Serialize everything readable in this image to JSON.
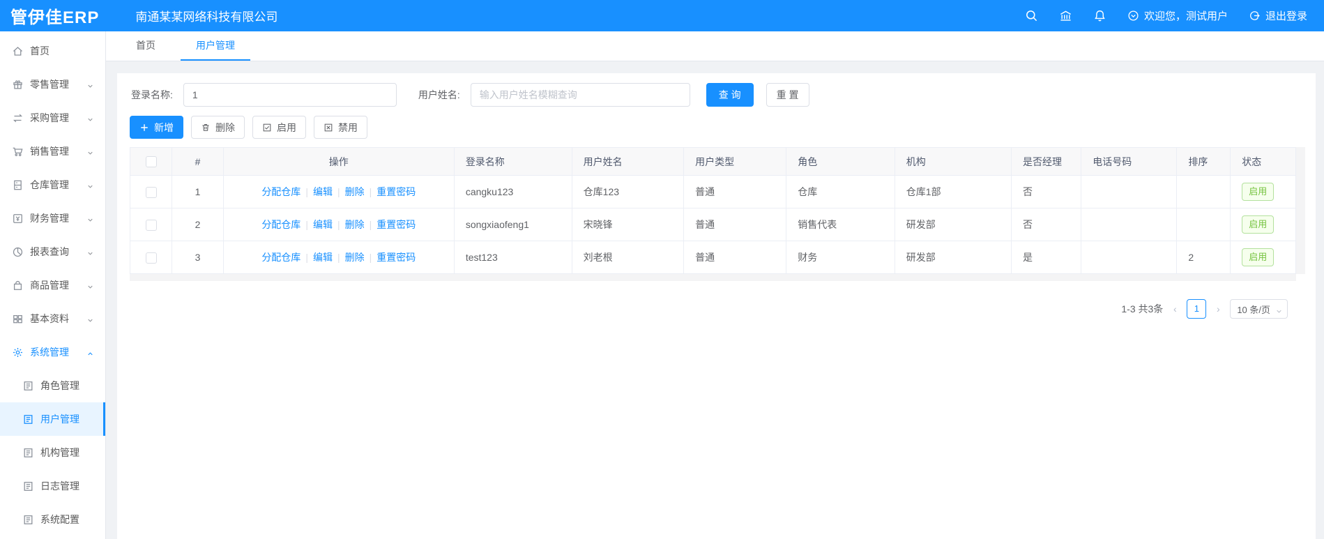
{
  "header": {
    "logo": "管伊佳ERP",
    "company": "南通某某网络科技有限公司",
    "welcome": "欢迎您，测试用户",
    "logout": "退出登录",
    "icons": [
      "search-icon",
      "bank-icon",
      "bell-icon",
      "user-circle-icon",
      "logout-icon"
    ]
  },
  "sidebar": {
    "items": [
      {
        "label": "首页",
        "icon": "home-icon",
        "has_children": false
      },
      {
        "label": "零售管理",
        "icon": "retail-icon",
        "has_children": true
      },
      {
        "label": "采购管理",
        "icon": "purchase-icon",
        "has_children": true
      },
      {
        "label": "销售管理",
        "icon": "sales-icon",
        "has_children": true
      },
      {
        "label": "仓库管理",
        "icon": "warehouse-icon",
        "has_children": true
      },
      {
        "label": "财务管理",
        "icon": "finance-icon",
        "has_children": true
      },
      {
        "label": "报表查询",
        "icon": "report-icon",
        "has_children": true
      },
      {
        "label": "商品管理",
        "icon": "product-icon",
        "has_children": true
      },
      {
        "label": "基本资料",
        "icon": "basic-data-icon",
        "has_children": true
      },
      {
        "label": "系统管理",
        "icon": "gear-icon",
        "has_children": true,
        "expanded": true,
        "active": true
      },
      {
        "label": "角色管理",
        "icon": "doc-icon",
        "sub": true
      },
      {
        "label": "用户管理",
        "icon": "doc-icon",
        "sub": true,
        "current": true
      },
      {
        "label": "机构管理",
        "icon": "doc-icon",
        "sub": true
      },
      {
        "label": "日志管理",
        "icon": "doc-icon",
        "sub": true
      },
      {
        "label": "系统配置",
        "icon": "doc-icon",
        "sub": true
      }
    ]
  },
  "tabs": [
    {
      "label": "首页",
      "active": false
    },
    {
      "label": "用户管理",
      "active": true
    }
  ],
  "search": {
    "login_label": "登录名称:",
    "login_value": "1",
    "name_label": "用户姓名:",
    "name_placeholder": "输入用户姓名模糊查询",
    "query_label": "查 询",
    "reset_label": "重 置"
  },
  "toolbar": {
    "add_label": "新增",
    "delete_label": "删除",
    "enable_label": "启用",
    "disable_label": "禁用"
  },
  "table": {
    "headers": [
      "#",
      "操作",
      "登录名称",
      "用户姓名",
      "用户类型",
      "角色",
      "机构",
      "是否经理",
      "电话号码",
      "排序",
      "状态"
    ],
    "action_links": [
      "分配仓库",
      "编辑",
      "删除",
      "重置密码"
    ],
    "rows": [
      {
        "index": "1",
        "login": "cangku123",
        "name": "仓库123",
        "type": "普通",
        "role": "仓库",
        "org": "仓库1部",
        "manager": "否",
        "phone": "",
        "sort": "",
        "status": "启用"
      },
      {
        "index": "2",
        "login": "songxiaofeng1",
        "name": "宋晓锋",
        "type": "普通",
        "role": "销售代表",
        "org": "研发部",
        "manager": "否",
        "phone": "",
        "sort": "",
        "status": "启用"
      },
      {
        "index": "3",
        "login": "test123",
        "name": "刘老根",
        "type": "普通",
        "role": "财务",
        "org": "研发部",
        "manager": "是",
        "phone": "",
        "sort": "2",
        "status": "启用"
      }
    ]
  },
  "pagination": {
    "total_text": "1-3 共3条",
    "prev": "‹",
    "next": "›",
    "current_page": "1",
    "page_size": "10 条/页"
  },
  "colors": {
    "primary": "#1890ff",
    "header_bg": "#1890ff",
    "active_item_bg": "#e8f4ff",
    "success_text": "#73c23c",
    "success_border": "#b3e19d",
    "page_bg": "#f0f2f5"
  }
}
